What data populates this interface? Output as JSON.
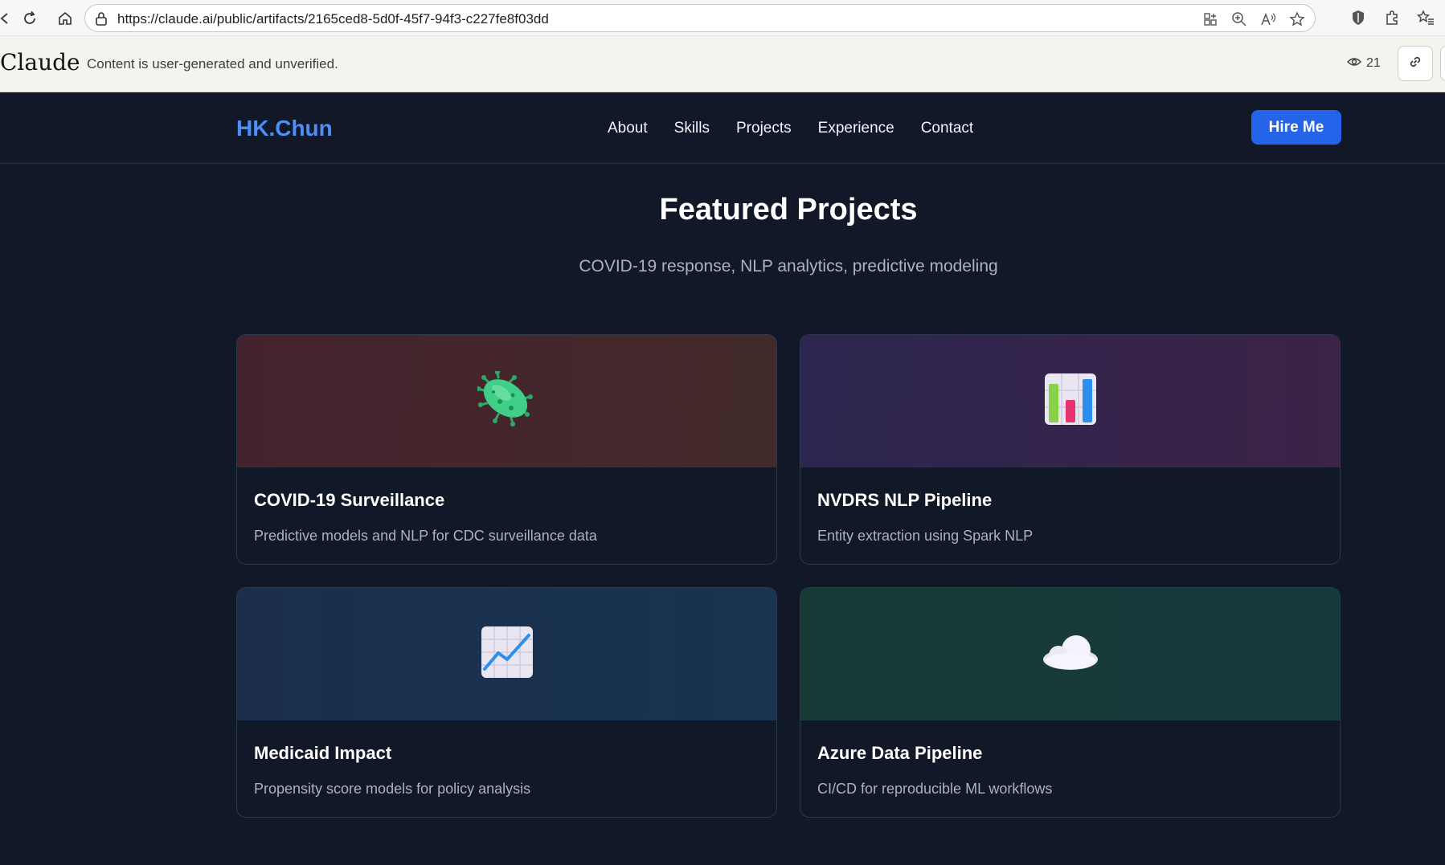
{
  "browser": {
    "url": "https://claude.ai/public/artifacts/2165ced8-5d0f-45f7-94f3-c227fe8f03dd"
  },
  "claude_bar": {
    "logo": "Claude",
    "notice": "Content is user-generated and unverified.",
    "view_count": "21"
  },
  "site_nav": {
    "brand": "HK.Chun",
    "links": [
      "About",
      "Skills",
      "Projects",
      "Experience",
      "Contact"
    ],
    "cta": "Hire Me"
  },
  "section": {
    "title": "Featured Projects",
    "subtitle": "COVID-19 response, NLP analytics, predictive modeling"
  },
  "projects": [
    {
      "title": "COVID-19 Surveillance",
      "description": "Predictive models and NLP for CDC surveillance data",
      "icon": "microbe-icon"
    },
    {
      "title": "NVDRS NLP Pipeline",
      "description": "Entity extraction using Spark NLP",
      "icon": "bar-chart-icon"
    },
    {
      "title": "Medicaid Impact",
      "description": "Propensity score models for policy analysis",
      "icon": "trend-chart-icon"
    },
    {
      "title": "Azure Data Pipeline",
      "description": "CI/CD for reproducible ML workflows",
      "icon": "cloud-icon"
    }
  ],
  "colors": {
    "page_bg": "#111827",
    "brand": "#4d8ef7",
    "cta_bg": "#2563eb"
  }
}
